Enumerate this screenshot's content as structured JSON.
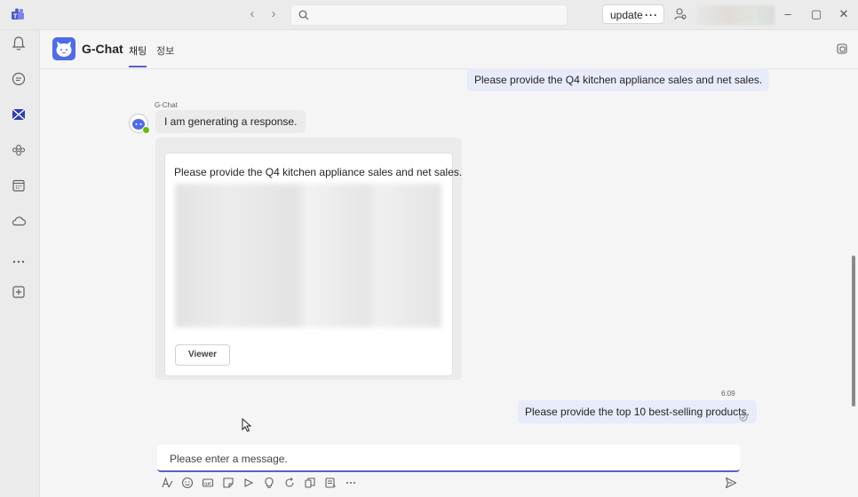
{
  "titlebar": {
    "update_label": "update",
    "more_label": "···"
  },
  "chat": {
    "title": "G-Chat",
    "tabs": [
      {
        "label": "채팅",
        "active": true
      },
      {
        "label": "정보",
        "active": false
      }
    ]
  },
  "messages": {
    "user_1": "Please provide the Q4 kitchen appliance sales and net sales.",
    "bot_sender": "G-Chat",
    "bot_status": "I am generating a response.",
    "card_title": "Please provide the Q4 kitchen appliance sales and net sales.",
    "viewer_label": "Viewer",
    "timestamp": "6:09",
    "user_2": "Please provide the top 10 best-selling products."
  },
  "compose": {
    "placeholder": "Please enter a message."
  },
  "colors": {
    "accent": "#5b5fc7",
    "bot_brand": "#4f6bed",
    "my_bubble": "#e8ebfa",
    "presence": "#6bb700"
  }
}
